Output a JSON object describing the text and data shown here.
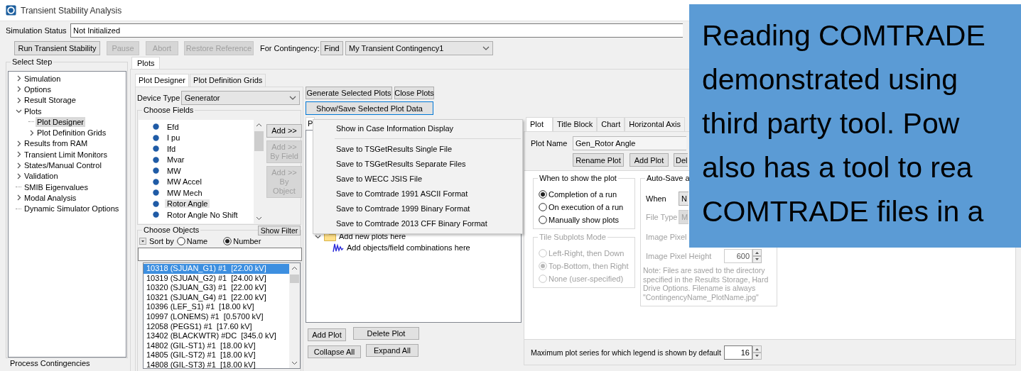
{
  "window": {
    "title": "Transient Stability Analysis"
  },
  "simulation_status": {
    "label": "Simulation Status",
    "value": "Not Initialized"
  },
  "toolbar": {
    "buttons": [
      {
        "label": "Run Transient Stability",
        "disabled": false
      },
      {
        "label": "Pause",
        "disabled": true
      },
      {
        "label": "Abort",
        "disabled": true
      },
      {
        "label": "Restore Reference",
        "disabled": true
      }
    ],
    "contingency_label": "For Contingency:",
    "find_button": "Find",
    "contingency": "My Transient Contingency1"
  },
  "select_step": {
    "title": "Select Step",
    "items": [
      {
        "label": "Simulation",
        "kind": "branch",
        "expanded": false,
        "selected": false
      },
      {
        "label": "Options",
        "kind": "branch",
        "expanded": false,
        "selected": false
      },
      {
        "label": "Result Storage",
        "kind": "branch",
        "expanded": false,
        "selected": false
      },
      {
        "label": "Plots",
        "kind": "branch",
        "expanded": true,
        "selected": false,
        "children": [
          {
            "label": "Plot Designer",
            "kind": "leaf",
            "expanded": false,
            "selected": true
          },
          {
            "label": "Plot Definition Grids",
            "kind": "branch",
            "expanded": false,
            "selected": false
          }
        ]
      },
      {
        "label": "Results from RAM",
        "kind": "branch",
        "expanded": false,
        "selected": false
      },
      {
        "label": "Transient Limit Monitors",
        "kind": "branch",
        "expanded": false,
        "selected": false
      },
      {
        "label": "States/Manual Control",
        "kind": "branch",
        "expanded": false,
        "selected": false
      },
      {
        "label": "Validation",
        "kind": "branch",
        "expanded": false,
        "selected": false
      },
      {
        "label": "SMIB Eigenvalues",
        "kind": "leaf",
        "expanded": false,
        "selected": false
      },
      {
        "label": "Modal Analysis",
        "kind": "branch",
        "expanded": false,
        "selected": false
      },
      {
        "label": "Dynamic Simulator Options",
        "kind": "leaf",
        "expanded": false,
        "selected": false
      }
    ],
    "footer": "Process Contingencies"
  },
  "main_tabs": [
    {
      "label": "Plots",
      "selected": true
    }
  ],
  "designer_tabs": [
    {
      "label": "Plot Designer",
      "selected": true
    },
    {
      "label": "Plot Definition Grids",
      "selected": false
    }
  ],
  "device_type": {
    "label": "Device Type",
    "value": "Generator"
  },
  "choose_fields": {
    "title": "Choose Fields",
    "items": [
      {
        "label": "Efd",
        "selected": false
      },
      {
        "label": "I pu",
        "selected": false
      },
      {
        "label": "Ifd",
        "selected": false
      },
      {
        "label": "Mvar",
        "selected": false
      },
      {
        "label": "MW",
        "selected": false
      },
      {
        "label": "MW Accel",
        "selected": false
      },
      {
        "label": "MW Mech",
        "selected": false
      },
      {
        "label": "Rotor Angle",
        "selected": true
      },
      {
        "label": "Rotor Angle No Shift",
        "selected": false
      }
    ],
    "buttons": [
      {
        "label": "Add >>",
        "disabled": false
      },
      {
        "label": "Add >>\nBy Field",
        "disabled": true
      },
      {
        "label": "Add >>\nBy Object",
        "disabled": true
      }
    ]
  },
  "choose_objects": {
    "title": "Choose Objects",
    "filter_button": "Show Filter",
    "sort_label": "Sort by",
    "sort_options": [
      {
        "label": "Name",
        "selected": false
      },
      {
        "label": "Number",
        "selected": true
      }
    ],
    "items": [
      {
        "label": "10318 (SJUAN_G1) #1  [22.00 kV]",
        "selected": true
      },
      {
        "label": "10319 (SJUAN_G2) #1  [24.00 kV]",
        "selected": false
      },
      {
        "label": "10320 (SJUAN_G3) #1  [22.00 kV]",
        "selected": false
      },
      {
        "label": "10321 (SJUAN_G4) #1  [22.00 kV]",
        "selected": false
      },
      {
        "label": "10396 (LEF_S1) #1  [18.00 kV]",
        "selected": false
      },
      {
        "label": "10997 (LONEMS) #1  [0.5700 kV]",
        "selected": false
      },
      {
        "label": "12058 (PEGS1) #1  [17.60 kV]",
        "selected": false
      },
      {
        "label": "13402 (BLACKWTR) #DC  [345.0 kV]",
        "selected": false
      },
      {
        "label": "14802 (GIL-ST1) #1  [18.00 kV]",
        "selected": false
      },
      {
        "label": "14805 (GIL-ST2) #1  [18.00 kV]",
        "selected": false
      },
      {
        "label": "14808 (GIL-ST3) #1  [18.00 kV]",
        "selected": false
      }
    ]
  },
  "plot_actions": {
    "buttons": [
      "Generate Selected Plots",
      "Close Plots"
    ],
    "data_button": "Show/Save Selected Plot Data"
  },
  "plot_menu": {
    "items": [
      {
        "kind": "item",
        "label": "Show in Case Information Display"
      },
      {
        "kind": "separator"
      },
      {
        "kind": "item",
        "label": "Save to TSGetResults Single File"
      },
      {
        "kind": "item",
        "label": "Save to TSGetResults Separate Files"
      },
      {
        "kind": "item",
        "label": "Save to WECC JSIS File"
      },
      {
        "kind": "item",
        "label": "Save to Comtrade 1991 ASCII Format"
      },
      {
        "kind": "item",
        "label": "Save to Comtrade 1999 Binary Format"
      },
      {
        "kind": "item",
        "label": "Save to Comtrade 2013 CFF Binary Format"
      }
    ]
  },
  "plot_tree": {
    "tab": "P",
    "items": [
      {
        "label": "Add new plots here",
        "kind": "folder",
        "expanded": true,
        "children": [
          {
            "label": "Add objects/field combinations here",
            "kind": "series"
          }
        ]
      }
    ]
  },
  "tree_buttons": [
    "Add Plot",
    "Delete Plot",
    "Collapse All",
    "Expand All"
  ],
  "plot_tabs": [
    {
      "label": "Plot",
      "selected": true
    },
    {
      "label": "Title Block",
      "selected": false
    },
    {
      "label": "Chart",
      "selected": false
    },
    {
      "label": "Horizontal Axis",
      "selected": false
    }
  ],
  "plot_name": {
    "label": "Plot Name",
    "value": "Gen_Rotor Angle"
  },
  "plot_buttons": [
    "Rename Plot",
    "Add Plot",
    "Del"
  ],
  "when_to_show": {
    "title": "When to show the plot",
    "disabled": false,
    "options": [
      {
        "label": "Completion of a run",
        "selected": true
      },
      {
        "label": "On execution of a run",
        "selected": false
      },
      {
        "label": "Manually show plots",
        "selected": false
      }
    ]
  },
  "tile_mode": {
    "title": "Tile Subplots Mode",
    "disabled": true,
    "options": [
      {
        "label": "Left-Right, then Down",
        "selected": false
      },
      {
        "label": "Top-Bottom, then Right",
        "selected": true
      },
      {
        "label": "None (user-specified)",
        "selected": false
      }
    ]
  },
  "auto_save": {
    "title": "Auto-Save a",
    "when_label": "When",
    "when_value": "N",
    "file_type_label": "File Type",
    "file_type_value": "M",
    "width_label": "Image Pixel",
    "height_label": "Image Pixel Height",
    "height_value": "600",
    "note": "Note: Files are saved to the directory specified in the Results Storage, Hard Drive Options.  Filename is always \"ContingencyName_PlotName.jpg\""
  },
  "legend": {
    "label": "Maximum plot series for which legend is shown by default",
    "value": "16"
  },
  "callout": {
    "lines": [
      "Reading COMTRADE",
      "demonstrated using",
      "third party tool. Pow",
      "also has a tool to rea",
      "COMTRADE files in a"
    ]
  }
}
